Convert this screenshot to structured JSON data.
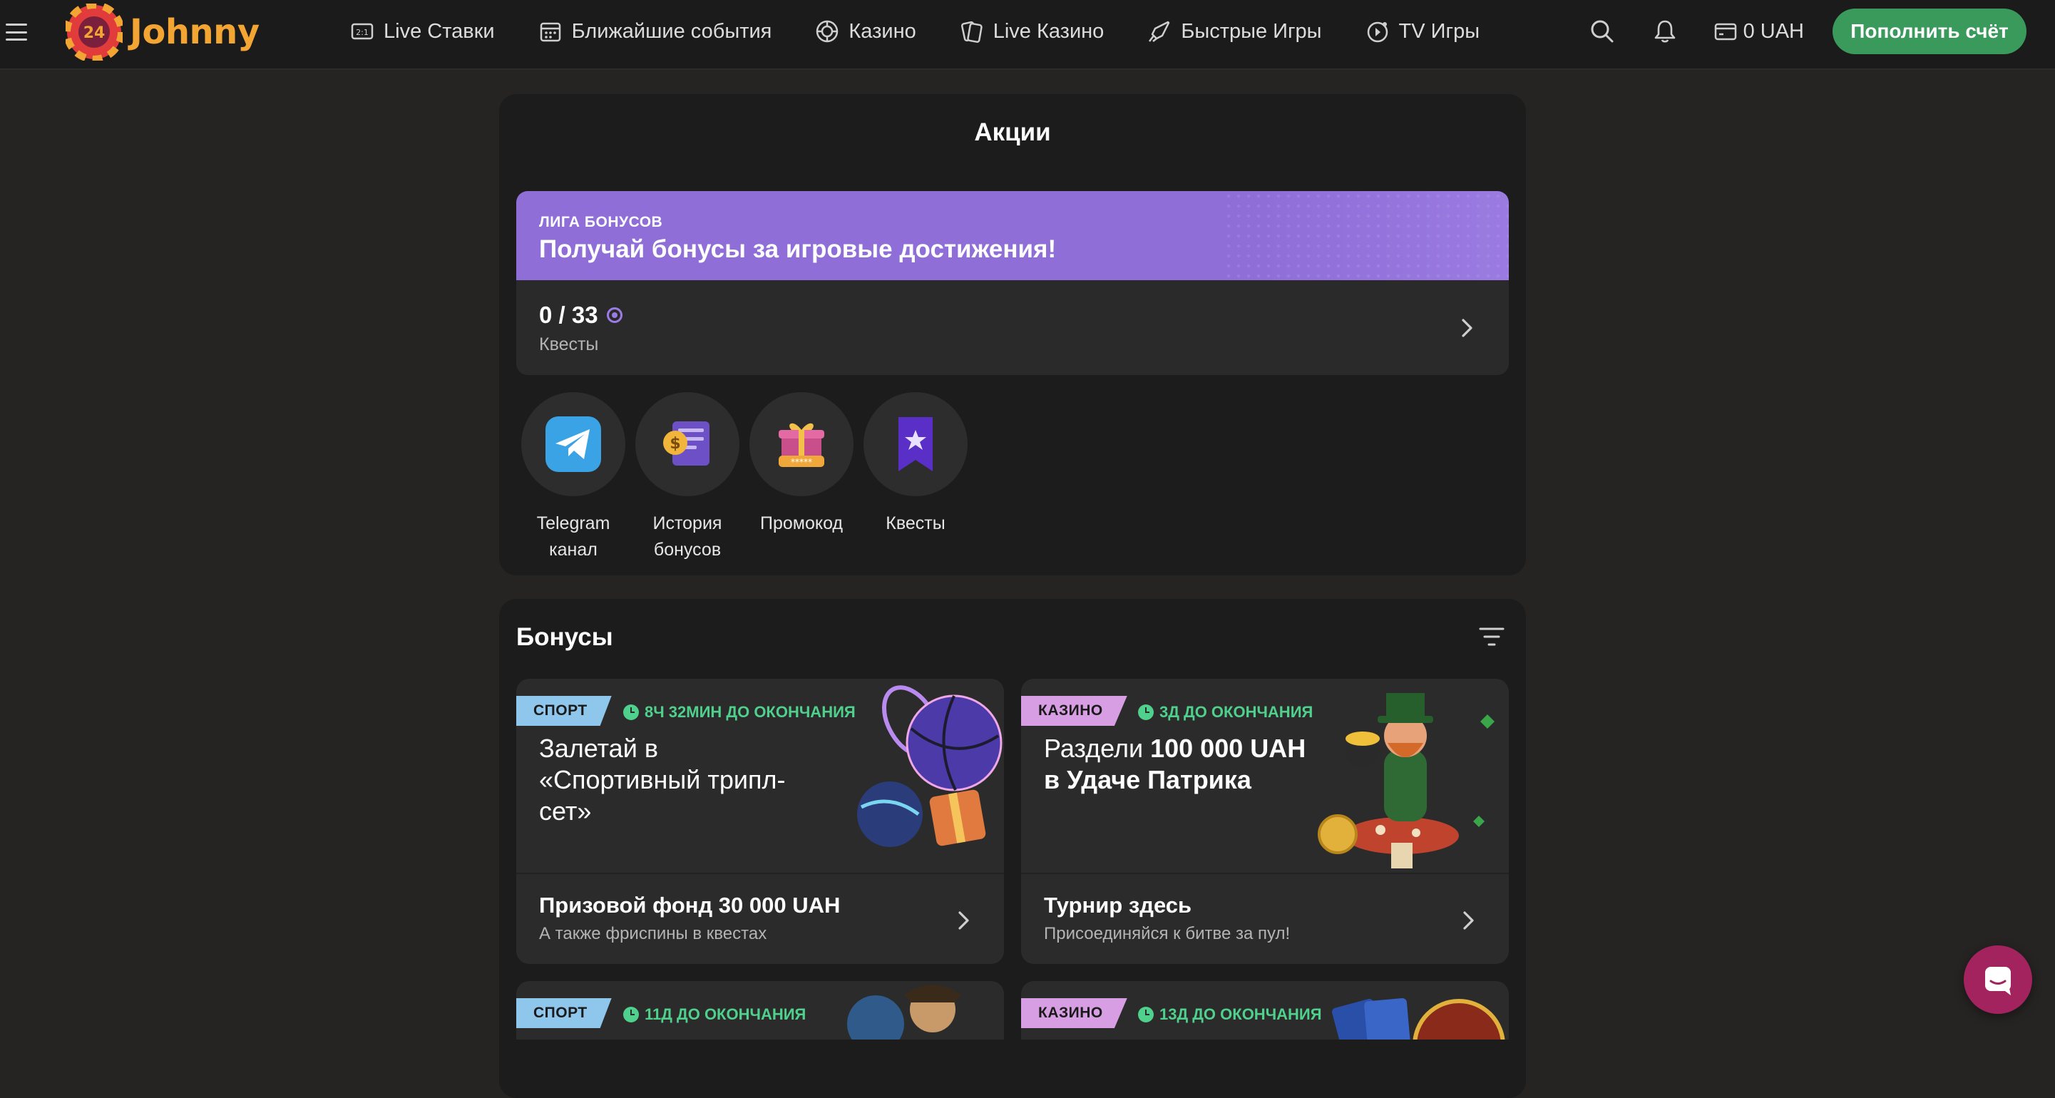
{
  "header": {
    "logo_text": "Johnny",
    "logo_badge": "24",
    "nav": [
      {
        "label": "Live Ставки",
        "icon": "live-bets-icon"
      },
      {
        "label": "Ближайшие события",
        "icon": "calendar-icon"
      },
      {
        "label": "Казино",
        "icon": "casino-chip-icon"
      },
      {
        "label": "Live Казино",
        "icon": "cards-icon"
      },
      {
        "label": "Быстрые Игры",
        "icon": "rocket-icon"
      },
      {
        "label": "TV Игры",
        "icon": "tv-games-icon"
      }
    ],
    "balance": "0 UAH",
    "deposit_label": "Пополнить счёт"
  },
  "promos": {
    "title": "Акции",
    "league": {
      "kicker": "ЛИГА БОНУСОВ",
      "title": "Получай бонусы за игровые достижения!"
    },
    "quests": {
      "count": "0 / 33",
      "label": "Квесты"
    },
    "quick_links": [
      {
        "label": "Telegram канал",
        "icon": "telegram-icon"
      },
      {
        "label": "История бонусов",
        "icon": "bonus-history-icon"
      },
      {
        "label": "Промокод",
        "icon": "gift-icon"
      },
      {
        "label": "Квесты",
        "icon": "quest-bookmark-icon"
      }
    ]
  },
  "bonuses": {
    "title": "Бонусы",
    "cards": [
      {
        "tag": "СПОРТ",
        "timer": "8Ч 32МИН ДО ОКОНЧАНИЯ",
        "headline": "Залетай в «Спортивный трипл-сет»",
        "foot_title": "Призовой фонд 30 000 UAH",
        "foot_sub": "А также фриспины в квестах"
      },
      {
        "tag": "КАЗИНО",
        "timer": "3Д ДО ОКОНЧАНИЯ",
        "headline_pre": "Раздели ",
        "headline_bold": "100 000 UAH в Удаче Патрика",
        "foot_title": "Турнир здесь",
        "foot_sub": "Присоединяйся к битве за пул!"
      },
      {
        "tag": "СПОРТ",
        "timer": "11Д ДО ОКОНЧАНИЯ"
      },
      {
        "tag": "КАЗИНО",
        "timer": "13Д ДО ОКОНЧАНИЯ"
      }
    ]
  },
  "colors": {
    "accent_green": "#3a9a5b",
    "league_purple": "#8f6ed8",
    "timer_green": "#4fd08c",
    "tag_sport": "#8fc7ec",
    "tag_casino": "#d89ee3",
    "logo_orange": "#f3a534"
  }
}
